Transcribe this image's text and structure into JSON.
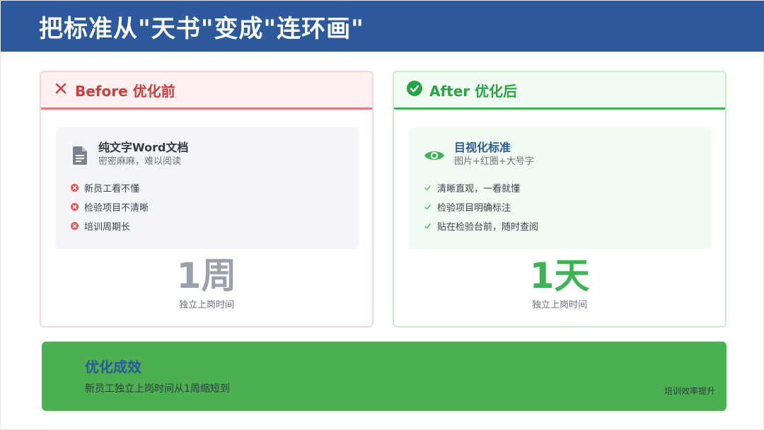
{
  "header": {
    "title": "把标准从\"天书\"变成\"连环画\""
  },
  "before": {
    "title": "Before 优化前",
    "icon": "close-icon",
    "accent": "#d33a3a",
    "doc_title": "纯文字Word文档",
    "doc_sub": "密密麻麻，难以阅读",
    "items": [
      "新员工看不懂",
      "检验项目不清晰",
      "培训周期长"
    ],
    "big_value": "1周",
    "big_label": "独立上岗时间"
  },
  "after": {
    "title": "After 优化后",
    "icon": "check-circle-icon",
    "accent": "#2aa345",
    "doc_title": "目视化标准",
    "doc_sub": "图片+红圈+大号字",
    "items": [
      "清晰直观，一看就懂",
      "检验项目明确标注",
      "贴在检验台前，随时查阅"
    ],
    "big_value": "1天",
    "big_label": "独立上岗时间"
  },
  "result": {
    "title": "优化成效",
    "desc": "新员工独立上岗时间从1周缩短到",
    "tag": "培训效率提升",
    "background": "#4caf50"
  }
}
